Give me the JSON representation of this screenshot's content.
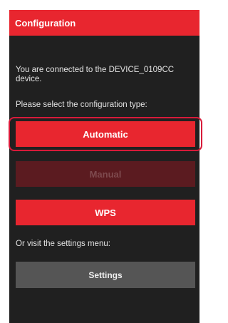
{
  "header": {
    "title": "Configuration"
  },
  "content": {
    "connected_text": "You are connected to the DEVICE_0109CC device.",
    "select_prompt": "Please select the configuration type:",
    "visit_prompt": "Or visit the settings menu:"
  },
  "buttons": {
    "automatic": "Automatic",
    "manual": "Manual",
    "wps": "WPS",
    "settings": "Settings"
  },
  "colors": {
    "accent": "#e8262f",
    "highlight_outline": "#d81b3a",
    "panel_background": "#202020",
    "disabled_button": "#5b1b20",
    "settings_button": "#555555"
  }
}
